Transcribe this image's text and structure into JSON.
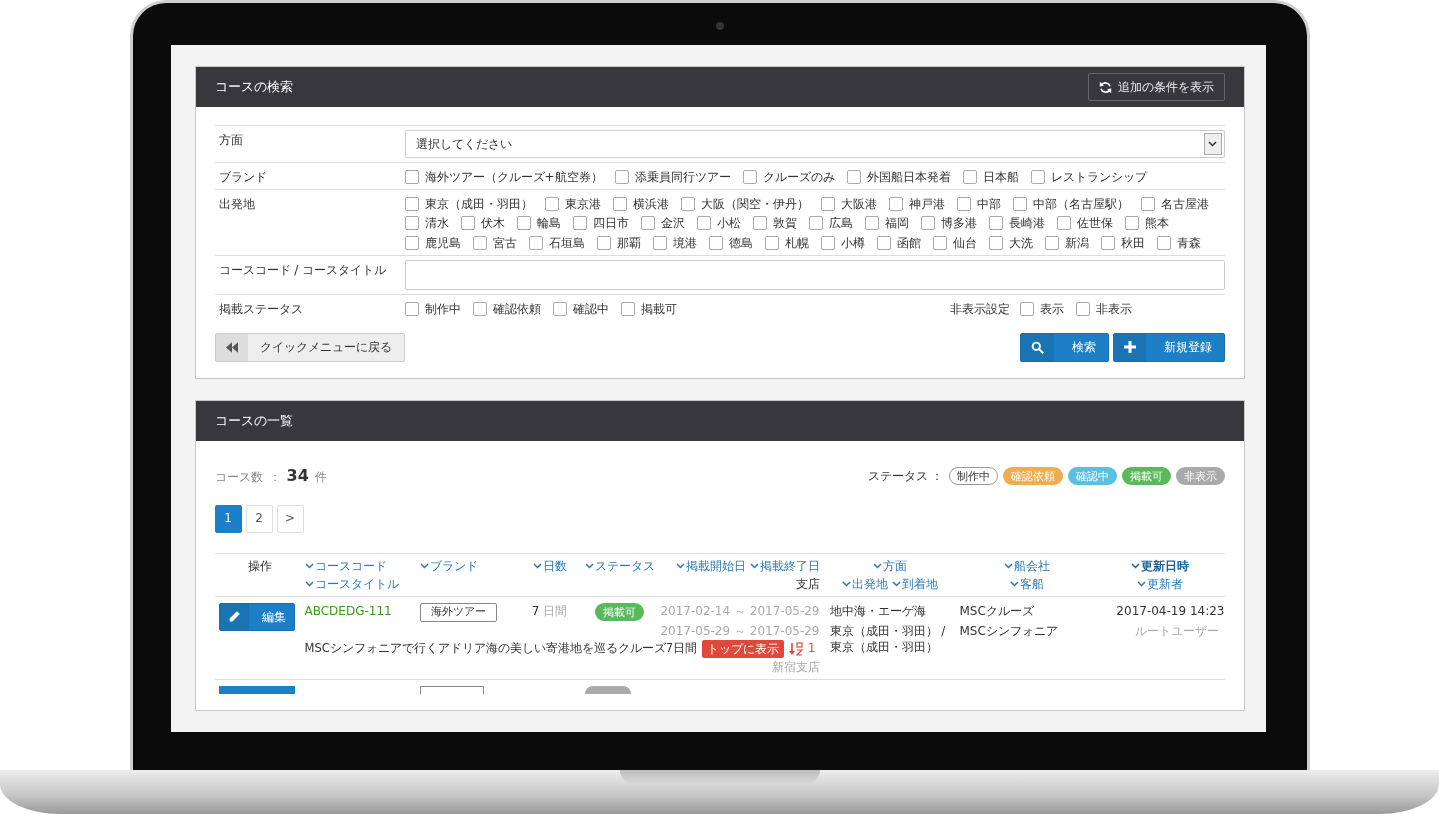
{
  "screen": {
    "search_panel": {
      "title": "コースの検索",
      "toggle_button": "追加の条件を表示",
      "fields": [
        {
          "kind": "select",
          "label": "方面",
          "value": "選択してください"
        },
        {
          "kind": "checks",
          "label": "ブランド",
          "options": [
            {
              "label": "海外ツアー（クルーズ+航空券）",
              "checked": false
            },
            {
              "label": "添乗員同行ツアー",
              "checked": false
            },
            {
              "label": "クルーズのみ",
              "checked": false
            },
            {
              "label": "外国船日本発着",
              "checked": false
            },
            {
              "label": "日本船",
              "checked": false
            },
            {
              "label": "レストランシップ",
              "checked": false
            }
          ]
        },
        {
          "kind": "checks",
          "label": "出発地",
          "options": [
            {
              "label": "東京（成田・羽田）",
              "checked": false
            },
            {
              "label": "東京港",
              "checked": false
            },
            {
              "label": "横浜港",
              "checked": false
            },
            {
              "label": "大阪（関空・伊丹）",
              "checked": false
            },
            {
              "label": "大阪港",
              "checked": false
            },
            {
              "label": "神戸港",
              "checked": false
            },
            {
              "label": "中部",
              "checked": false
            },
            {
              "label": "中部（名古屋駅）",
              "checked": false
            },
            {
              "label": "名古屋港",
              "checked": false
            },
            {
              "label": "清水",
              "checked": false
            },
            {
              "label": "伏木",
              "checked": false
            },
            {
              "label": "輪島",
              "checked": false
            },
            {
              "label": "四日市",
              "checked": false
            },
            {
              "label": "金沢",
              "checked": false
            },
            {
              "label": "小松",
              "checked": false
            },
            {
              "label": "敦賀",
              "checked": false
            },
            {
              "label": "広島",
              "checked": false
            },
            {
              "label": "福岡",
              "checked": false
            },
            {
              "label": "博多港",
              "checked": false
            },
            {
              "label": "長崎港",
              "checked": false
            },
            {
              "label": "佐世保",
              "checked": false
            },
            {
              "label": "熊本",
              "checked": false
            },
            {
              "label": "鹿児島",
              "checked": false
            },
            {
              "label": "宮古",
              "checked": false
            },
            {
              "label": "石垣島",
              "checked": false
            },
            {
              "label": "那覇",
              "checked": false
            },
            {
              "label": "境港",
              "checked": false
            },
            {
              "label": "徳島",
              "checked": false
            },
            {
              "label": "札幌",
              "checked": false
            },
            {
              "label": "小樽",
              "checked": false
            },
            {
              "label": "函館",
              "checked": false
            },
            {
              "label": "仙台",
              "checked": false
            },
            {
              "label": "大洗",
              "checked": false
            },
            {
              "label": "新潟",
              "checked": false
            },
            {
              "label": "秋田",
              "checked": false
            },
            {
              "label": "青森",
              "checked": false
            }
          ]
        },
        {
          "kind": "text",
          "label": "コースコード / コースタイトル"
        },
        {
          "kind": "checks",
          "label": "掲載ステータス",
          "options": [
            {
              "label": "制作中",
              "checked": false
            },
            {
              "label": "確認依頼",
              "checked": false
            },
            {
              "label": "確認中",
              "checked": false
            },
            {
              "label": "掲載可",
              "checked": false
            }
          ],
          "extra": {
            "label": "非表示設定",
            "options": [
              {
                "label": "表示",
                "checked": false
              },
              {
                "label": "非表示",
                "checked": false
              }
            ]
          }
        }
      ],
      "back_button": "クイックメニューに戻る",
      "search_button": "検索",
      "new_button": "新規登録"
    },
    "list_panel": {
      "title": "コースの一覧",
      "count": {
        "label": "コース数",
        "separator": "：",
        "value": "34",
        "unit": "件"
      },
      "legend": {
        "label": "ステータス ：",
        "items": [
          {
            "label": "制作中",
            "color": "#ffffff"
          },
          {
            "label": "確認依頼",
            "color": "#f0ad4e"
          },
          {
            "label": "確認中",
            "color": "#5bc0de"
          },
          {
            "label": "掲載可",
            "color": "#5cb85c"
          },
          {
            "label": "非表示",
            "color": "#aaaaaa"
          }
        ]
      },
      "pagination": [
        {
          "label": "1",
          "selected": true
        },
        {
          "label": "2",
          "selected": false
        },
        {
          "label": ">",
          "selected": false
        }
      ],
      "header": [
        {
          "lines": [
            [
              {
                "label": "操作",
                "sortable": false,
                "bold": false
              }
            ]
          ]
        },
        {
          "lines": [
            [
              {
                "label": "コースコード",
                "sortable": true,
                "bold": false
              }
            ],
            [
              {
                "label": "コースタイトル",
                "sortable": true,
                "bold": false
              }
            ]
          ]
        },
        {
          "lines": [
            [
              {
                "label": "ブランド",
                "sortable": true,
                "bold": false
              }
            ]
          ]
        },
        {
          "lines": [
            [
              {
                "label": "日数",
                "sortable": true,
                "bold": false
              }
            ]
          ]
        },
        {
          "lines": [
            [
              {
                "label": "ステータス",
                "sortable": true,
                "bold": false
              }
            ]
          ]
        },
        {
          "lines": [
            [
              {
                "label": "掲載開始日",
                "sortable": true,
                "bold": false
              },
              {
                "label": "掲載終了日",
                "sortable": true,
                "bold": false
              }
            ]
          ],
          "footer": "支店"
        },
        {
          "lines": [
            [
              {
                "label": "方面",
                "sortable": true,
                "bold": false
              }
            ],
            [
              {
                "label": "出発地",
                "sortable": true,
                "bold": false
              },
              {
                "label": "到着地",
                "sortable": true,
                "bold": false
              }
            ]
          ]
        },
        {
          "lines": [
            [
              {
                "label": "船会社",
                "sortable": true,
                "bold": false
              }
            ],
            [
              {
                "label": "客船",
                "sortable": true,
                "bold": false
              }
            ]
          ]
        },
        {
          "lines": [
            [
              {
                "label": "更新日時",
                "sortable": true,
                "bold": true
              }
            ],
            [
              {
                "label": "更新者",
                "sortable": true,
                "bold": false
              }
            ]
          ]
        }
      ],
      "rows": [
        {
          "kind": "full",
          "edit_button": "編集",
          "code": "ABCDEDG-111",
          "brand": "海外ツアー",
          "days": "7",
          "days_unit": "日間",
          "status": "掲載可",
          "color": "#5cb85c",
          "dates": [
            "2017-02-14 ～ 2017-05-29",
            "2017-05-29 ～ 2017-05-29"
          ],
          "title": "MSCシンフォニアで行くアドリア海の美しい寄港地を巡るクルーズ7日間",
          "top_badge": "トップに表示",
          "rank": "1",
          "branch": "新宿支店",
          "direction": "地中海・エーゲ海",
          "ports": "東京（成田・羽田） / 東京（成田・羽田）",
          "company": "MSCクルーズ",
          "ship": "MSCシンフォニア",
          "updated": "2017-04-19 14:23",
          "user": "ルートユーザー"
        },
        {
          "kind": "partial",
          "color": "#aaaaaa"
        }
      ]
    }
  }
}
